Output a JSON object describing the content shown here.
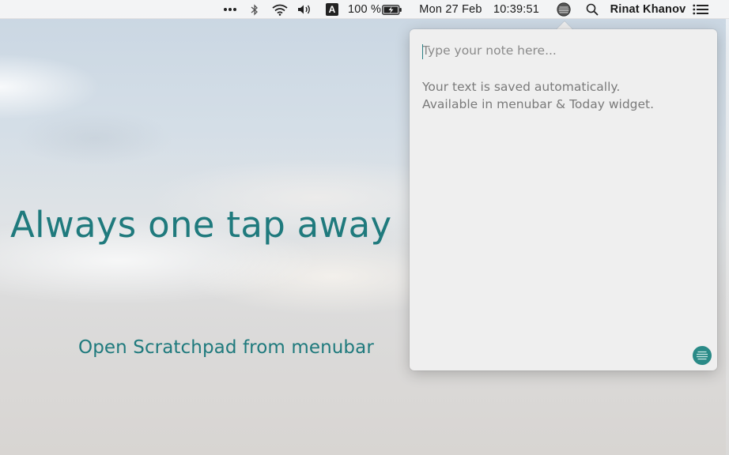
{
  "menubar": {
    "more_icon": "ellipsis-icon",
    "input_source_label": "A",
    "battery_percent": "100 %",
    "date": "Mon 27 Feb",
    "time": "10:39:51",
    "user_name": "Rinat Khanov"
  },
  "hero": {
    "title": "Always one tap away",
    "subtitle": "Open Scratchpad from menubar"
  },
  "popover": {
    "note_placeholder": "Type your note here...",
    "hint_line1": "Your text is saved automatically.",
    "hint_line2": "Available in menubar & Today widget."
  },
  "colors": {
    "accent": "#1f7a7d",
    "popover_bg": "#efefef",
    "menubar_bg": "#f6f6f6"
  }
}
